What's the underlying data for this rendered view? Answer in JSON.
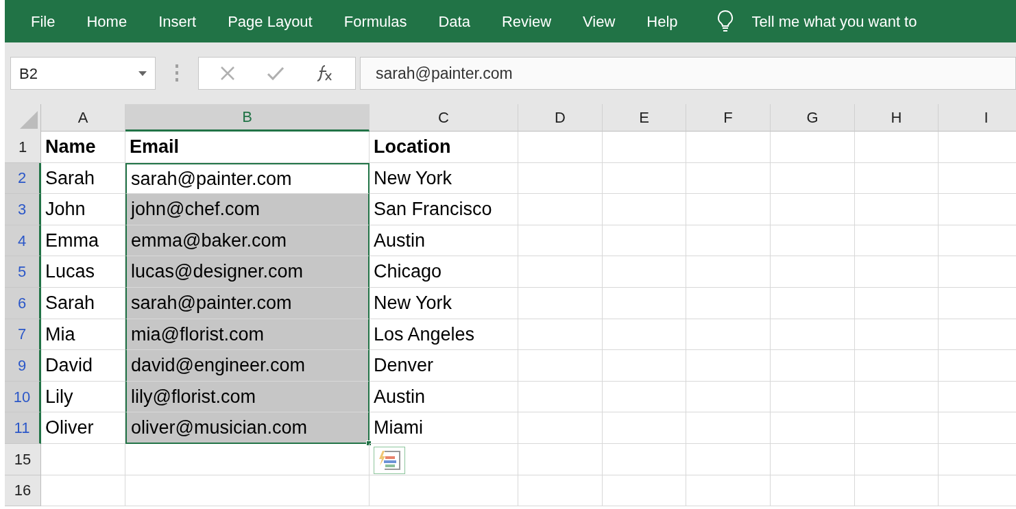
{
  "ribbon": {
    "tabs": [
      "File",
      "Home",
      "Insert",
      "Page Layout",
      "Formulas",
      "Data",
      "Review",
      "View",
      "Help"
    ],
    "tell_me": "Tell me what you want to"
  },
  "formula_bar": {
    "name_box": "B2",
    "value": "sarah@painter.com"
  },
  "columns": [
    {
      "label": "A",
      "selected": false
    },
    {
      "label": "B",
      "selected": true
    },
    {
      "label": "C",
      "selected": false
    },
    {
      "label": "D",
      "selected": false
    },
    {
      "label": "E",
      "selected": false
    },
    {
      "label": "F",
      "selected": false
    },
    {
      "label": "G",
      "selected": false
    },
    {
      "label": "H",
      "selected": false
    },
    {
      "label": "I",
      "selected": false
    }
  ],
  "rows": [
    {
      "number": "1",
      "kind": "header",
      "selected": false,
      "highlighted": false,
      "cells": [
        "Name",
        "Email",
        "Location"
      ]
    },
    {
      "number": "2",
      "kind": "data",
      "selected": true,
      "highlighted": false,
      "cells": [
        "Sarah",
        "sarah@painter.com",
        "New York"
      ]
    },
    {
      "number": "3",
      "kind": "data",
      "selected": true,
      "highlighted": true,
      "cells": [
        "John",
        "john@chef.com",
        "San Francisco"
      ]
    },
    {
      "number": "4",
      "kind": "data",
      "selected": true,
      "highlighted": true,
      "cells": [
        "Emma",
        "emma@baker.com",
        "Austin"
      ]
    },
    {
      "number": "5",
      "kind": "data",
      "selected": true,
      "highlighted": true,
      "cells": [
        "Lucas",
        "lucas@designer.com",
        "Chicago"
      ]
    },
    {
      "number": "6",
      "kind": "data",
      "selected": true,
      "highlighted": true,
      "cells": [
        "Sarah",
        "sarah@painter.com",
        "New York"
      ]
    },
    {
      "number": "7",
      "kind": "data",
      "selected": true,
      "highlighted": true,
      "cells": [
        "Mia",
        "mia@florist.com",
        "Los Angeles"
      ]
    },
    {
      "number": "9",
      "kind": "data",
      "selected": true,
      "highlighted": true,
      "cells": [
        "David",
        "david@engineer.com",
        "Denver"
      ]
    },
    {
      "number": "10",
      "kind": "data",
      "selected": true,
      "highlighted": true,
      "cells": [
        "Lily",
        "lily@florist.com",
        "Austin"
      ]
    },
    {
      "number": "11",
      "kind": "data",
      "selected": true,
      "highlighted": true,
      "cells": [
        "Oliver",
        "oliver@musician.com",
        "Miami"
      ]
    },
    {
      "number": "15",
      "kind": "data",
      "selected": false,
      "highlighted": false
    },
    {
      "number": "16",
      "kind": "data",
      "selected": false,
      "highlighted": false
    }
  ]
}
